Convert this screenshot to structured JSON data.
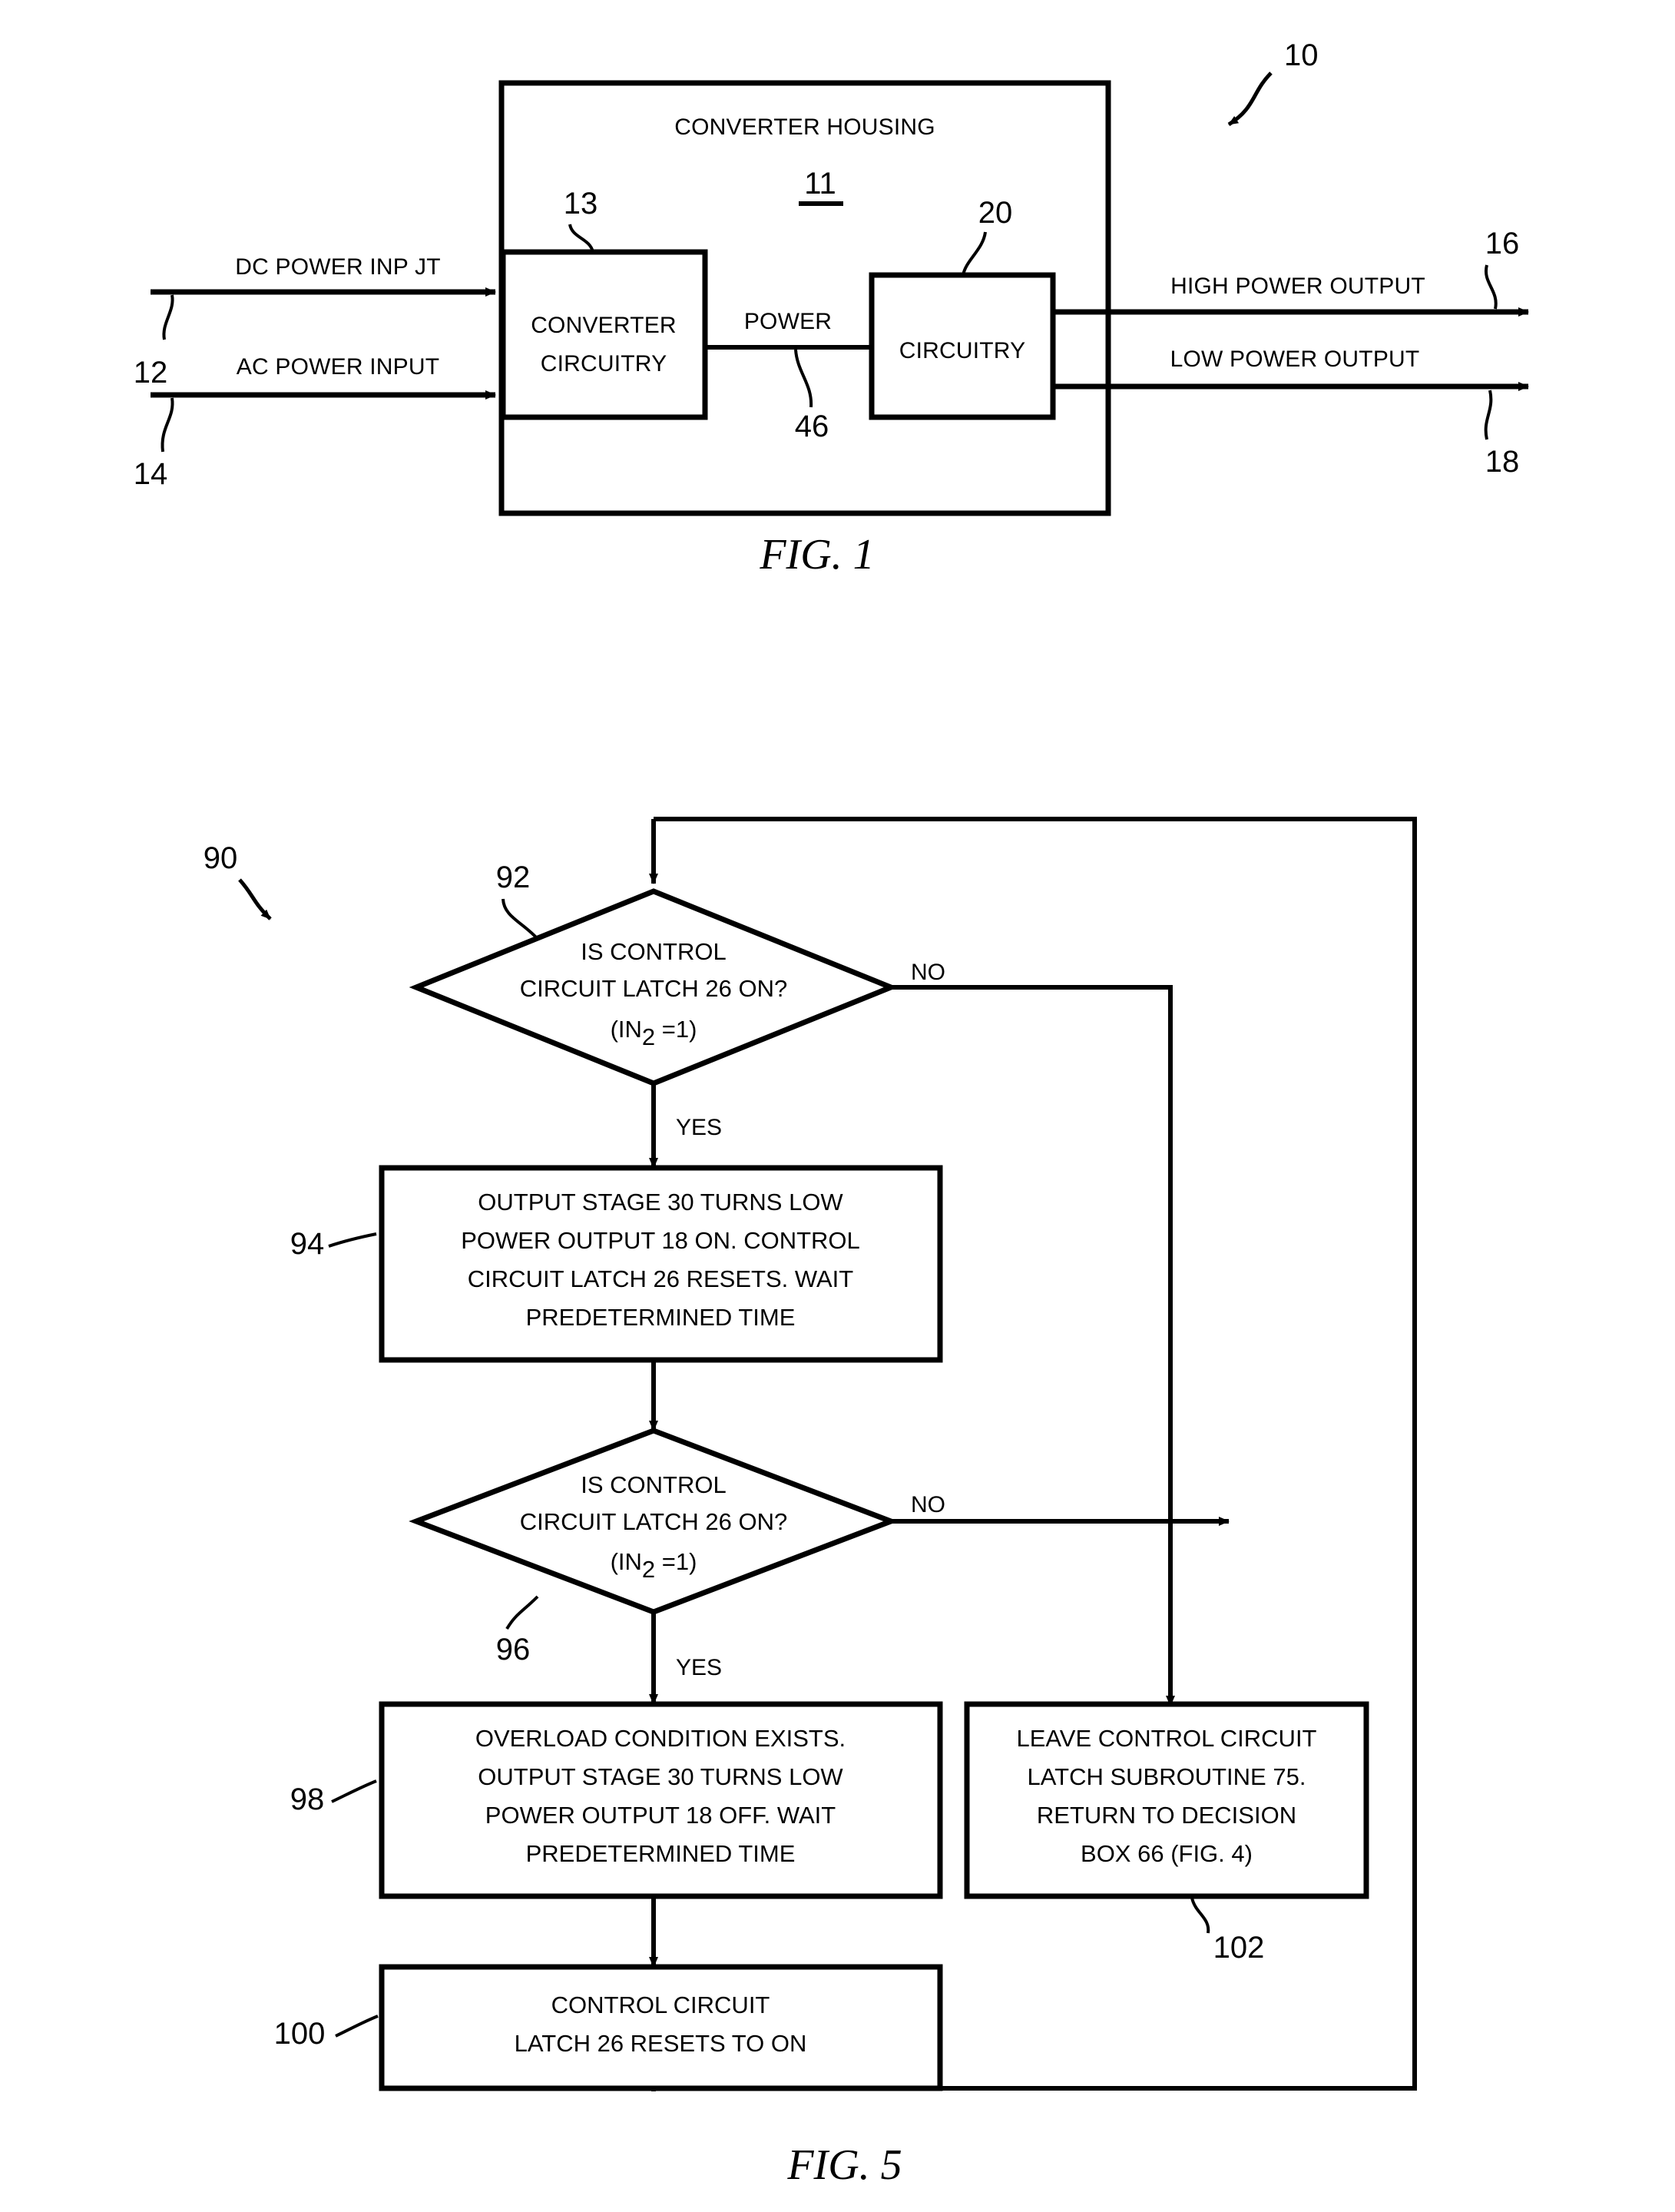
{
  "figure1": {
    "caption": "FIG. 1",
    "system_ref": "10",
    "housing": {
      "title": "CONVERTER HOUSING",
      "ref": "11"
    },
    "converter_block": {
      "line1": "CONVERTER",
      "line2": "CIRCUITRY",
      "ref": "13"
    },
    "circuitry_block": {
      "label": "CIRCUITRY",
      "ref": "20"
    },
    "power_link": {
      "label": "POWER",
      "ref": "46"
    },
    "inputs": [
      {
        "label": "DC POWER INP JT",
        "ref": "12"
      },
      {
        "label": "AC POWER INPUT",
        "ref": "14"
      }
    ],
    "outputs": [
      {
        "label": "HIGH POWER OUTPUT",
        "ref": "16"
      },
      {
        "label": "LOW POWER OUTPUT",
        "ref": "18"
      }
    ]
  },
  "figure5": {
    "caption": "FIG. 5",
    "flow_ref": "90",
    "decision1": {
      "ref": "92",
      "line1": "IS CONTROL",
      "line2": "CIRCUIT LATCH 26 ON?",
      "cond_pre": "(IN",
      "cond_sub": "2",
      "cond_post": " =1)",
      "no_label": "NO",
      "yes_label": "YES"
    },
    "process94": {
      "ref": "94",
      "lines": [
        "OUTPUT STAGE 30 TURNS LOW",
        "POWER OUTPUT 18 ON. CONTROL",
        "CIRCUIT LATCH 26 RESETS. WAIT",
        "PREDETERMINED TIME"
      ]
    },
    "decision2": {
      "ref": "96",
      "line1": "IS CONTROL",
      "line2": "CIRCUIT LATCH 26 ON?",
      "cond_pre": "(IN",
      "cond_sub": "2",
      "cond_post": " =1)",
      "no_label": "NO",
      "yes_label": "YES"
    },
    "process98": {
      "ref": "98",
      "lines": [
        "OVERLOAD CONDITION EXISTS.",
        "OUTPUT STAGE 30 TURNS LOW",
        "POWER OUTPUT 18 OFF. WAIT",
        "PREDETERMINED TIME"
      ]
    },
    "process100": {
      "ref": "100",
      "lines": [
        "CONTROL CIRCUIT",
        "LATCH 26 RESETS TO ON"
      ]
    },
    "process102": {
      "ref": "102",
      "lines": [
        "LEAVE CONTROL CIRCUIT",
        "LATCH SUBROUTINE 75.",
        "RETURN TO DECISION",
        "BOX 66  (FIG. 4)"
      ]
    }
  }
}
